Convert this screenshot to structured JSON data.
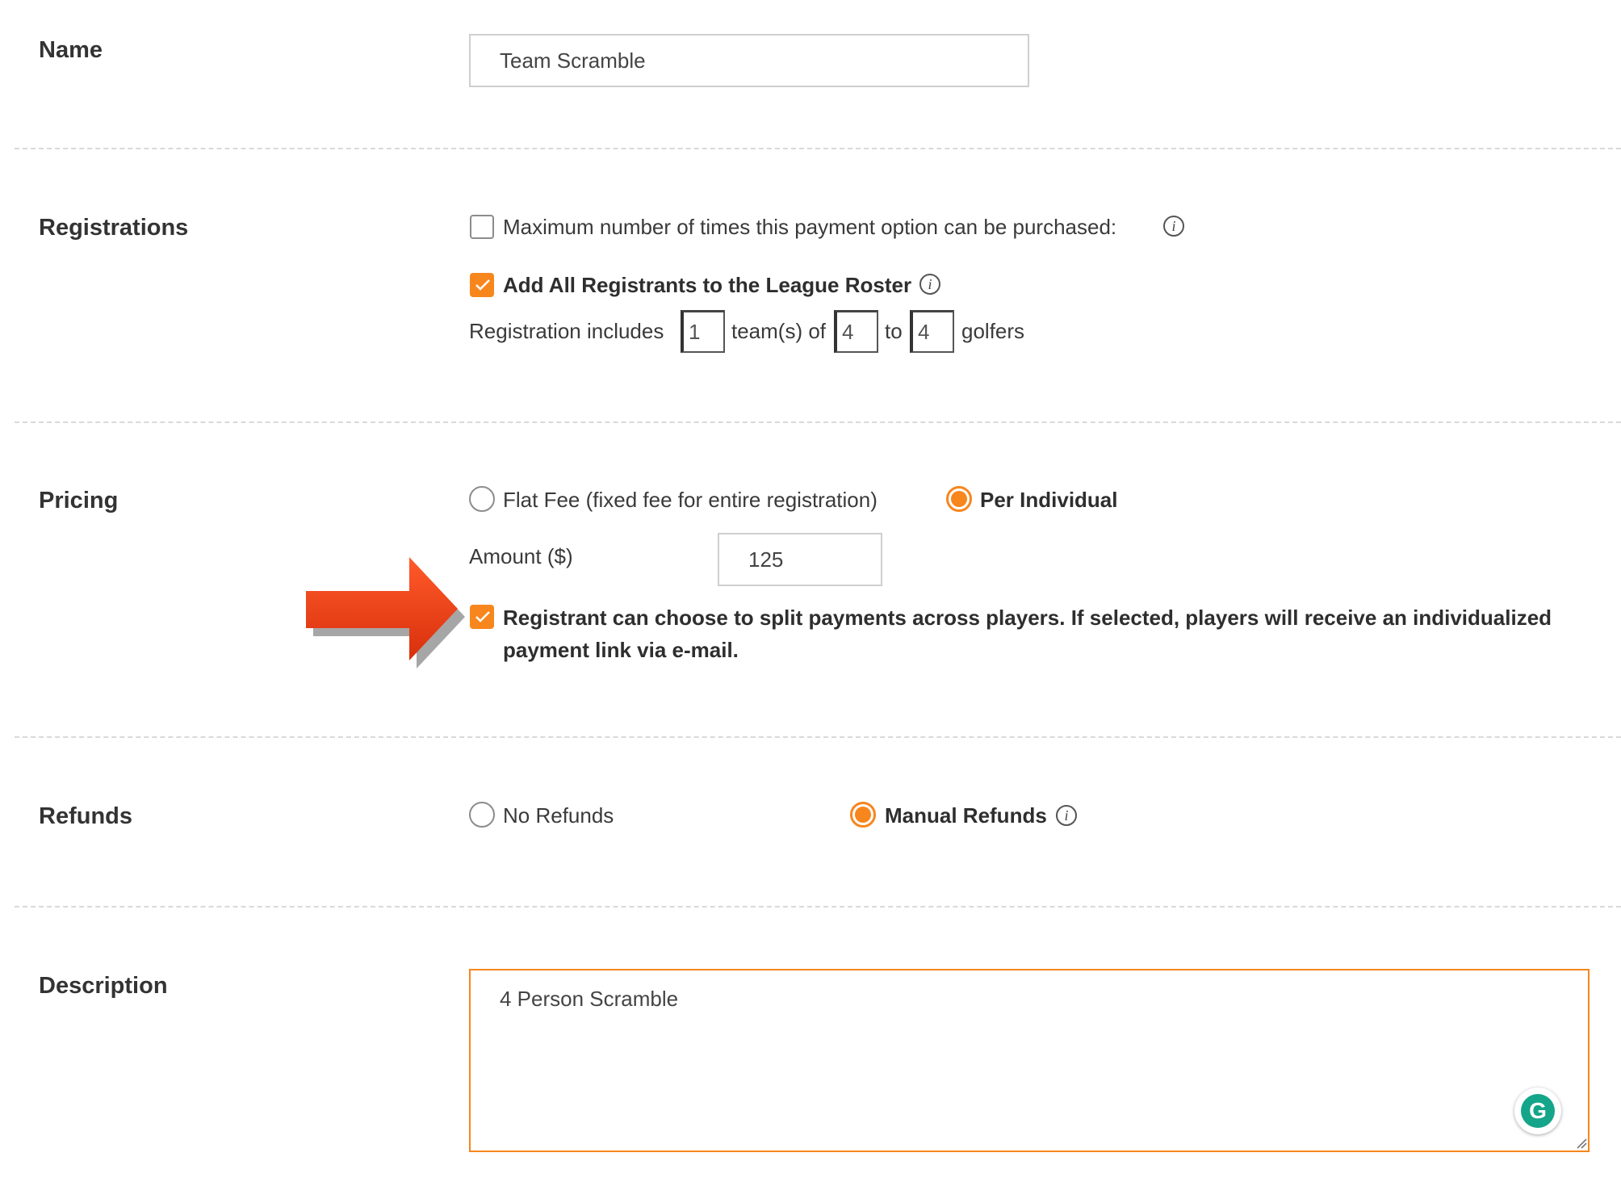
{
  "name_section": {
    "label": "Name",
    "value": "Team Scramble"
  },
  "registrations_section": {
    "label": "Registrations",
    "max_purchases": {
      "checked": false,
      "label": "Maximum number of times this payment option can be purchased:",
      "info_icon": "info-icon"
    },
    "add_to_roster": {
      "checked": true,
      "label": "Add All Registrants to the League Roster",
      "info_icon": "info-icon"
    },
    "team_config": {
      "prefix": "Registration includes",
      "teams_value": "1",
      "teams_suffix": "team(s) of",
      "min_value": "4",
      "to_text": "to",
      "max_value": "4",
      "suffix": "golfers"
    }
  },
  "pricing_section": {
    "label": "Pricing",
    "options": [
      {
        "label": "Flat Fee (fixed fee for entire registration)",
        "selected": false
      },
      {
        "label": "Per Individual",
        "selected": true
      }
    ],
    "amount_label": "Amount ($)",
    "amount_value": "125",
    "split_payments": {
      "checked": true,
      "line1": "Registrant can choose to split payments across players. If selected, players will receive an individualized",
      "line2": "payment link via e-mail."
    },
    "annotation": "arrow-icon"
  },
  "refunds_section": {
    "label": "Refunds",
    "options": [
      {
        "label": "No Refunds",
        "selected": false
      },
      {
        "label": "Manual Refunds",
        "selected": true
      }
    ],
    "info_icon": "info-icon"
  },
  "description_section": {
    "label": "Description",
    "value": "4 Person Scramble",
    "grammarly_icon": "grammarly-icon"
  },
  "colors": {
    "accent": "#f7861d",
    "arrow": "#e8401a",
    "grammarly": "#15a58a"
  }
}
